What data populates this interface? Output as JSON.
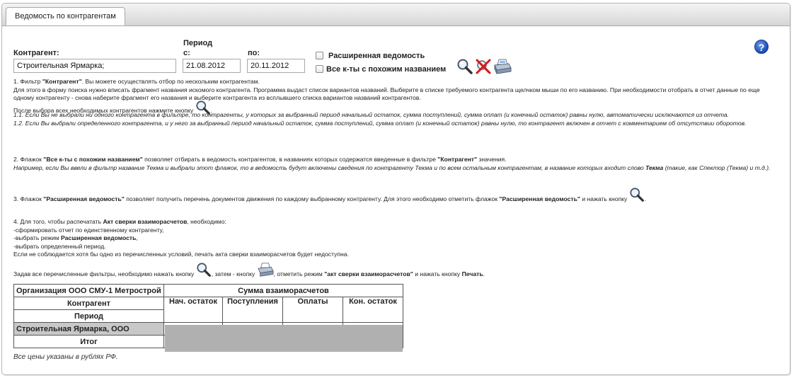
{
  "tab": {
    "label": "Ведомость по контрагентам"
  },
  "filters": {
    "contractor_label": "Контрагент:",
    "contractor_value": "Строительная Ярмарка;",
    "period_label": "Период",
    "from_label": "с:",
    "from_value": "21.08.2012",
    "to_label": "по:",
    "to_value": "20.11.2012",
    "extended_label": "Расширенная ведомость",
    "similar_label": "Все к-ты с похожим названием"
  },
  "help": {
    "glyph": "?"
  },
  "instructions": {
    "p1_a": "1. Фильтр ",
    "p1_b": "\"Контрагент\"",
    "p1_c": ". Вы можете осуществлять отбор по нескольким контрагентам.",
    "p1_line2": "Для этого в форму поиска нужно вписать фрагмент названия искомого контрагента. Программа выдаст список вариантов названий. Выберите в списке требуемого контрагента щелчком мыши по его названию. При необходимости отобрать в отчет данные по еще одному контрагенту - снова наберите фрагмент его названия и выберите контрагента из всплывшего списка вариантов названий контрагентов.",
    "p1_after": "После выбора всех необходимых контрагентов нажмите кнопку",
    "p1_11": "1.1. Если Вы не выбрали ни одного контрагента в фильтре, то контрагенты, у которых за выбранный период начальный остаток, сумма поступлений, сумма оплат (и конечный остаток) равны нулю, автоматически исключаются из отчета.",
    "p1_12": "1.2. Если Вы выбрали определенного контрагента, и у него за выбранный период начальный остаток, сумма поступлений, сумма оплат (и конечный остаток) равны нулю, то контрагент включен в отчет с комментарием об отсутствии оборотов.",
    "p2_a": "2. Флажок ",
    "p2_b": "\"Все к-ты с похожим названием\"",
    "p2_c": " позволяет отбирать в ведомость контрагентов, в названиях которых содержатся введенные в фильтре ",
    "p2_d": "\"Контрагент\"",
    "p2_e": " значения.",
    "p2_ex1": "Например, если Вы ввели в фильтр название Текма и выбрали этот флажок, то в ведомость будут включены сведения по контрагенту Текма и по всем остальным контрагентам, в название которых входит слово ",
    "p2_ex2": "Текма",
    "p2_ex3": " (такие, как Спектор (Текма) и т.д.).",
    "p3_a": "3. Флажок ",
    "p3_b": "\"Расширенная ведомость\"",
    "p3_c": " позволяет получить перечень документов движения по каждому выбранному контрагенту. Для этого необходимо отметить флажок ",
    "p3_d": "\"Расширенная ведомость\"",
    "p3_e": " и нажать кнопку",
    "p3_f": ".",
    "p4_a": "4. Для того, чтобы распечатать ",
    "p4_b": "Акт сверки взаиморасчетов",
    "p4_c": ", необходимо:",
    "p4_l1": "-сформировать отчет по единственному контрагенту,",
    "p4_l2a": "-выбрать режим ",
    "p4_l2b": "Расширенная ведомость",
    "p4_l2c": ",",
    "p4_l3": "-выбрать определенный период.",
    "p4_l4": "Если не соблюдается хотя бы одно из перечисленных условий, печать акта сверки взаиморасчетов будет недоступна.",
    "p5_a": "Задав все перечисленные фильтры, необходимо нажать кнопку",
    "p5_b": ", затем - кнопку",
    "p5_c": ", отметить режим ",
    "p5_d": "\"акт сверки взаиморасчетов\"",
    "p5_e": " и нажать кнопку ",
    "p5_f": "Печать",
    "p5_g": "."
  },
  "report": {
    "org_header": "Организация ООО СМУ-1 Метрострой",
    "sum_header": "Сумма взаиморасчетов",
    "contractor_header": "Контрагент",
    "period_header": "Период",
    "columns": [
      "Нач. остаток",
      "Поступления",
      "Оплаты",
      "Кон. остаток"
    ],
    "row_name": "Строительная Ярмарка, ООО",
    "total_label": "Итог"
  },
  "footnote": "Все цены указаны в рублях РФ.",
  "icons": {
    "search": "search-icon",
    "clear": "clear-filter-icon",
    "print": "printer-icon",
    "help": "help-icon"
  }
}
